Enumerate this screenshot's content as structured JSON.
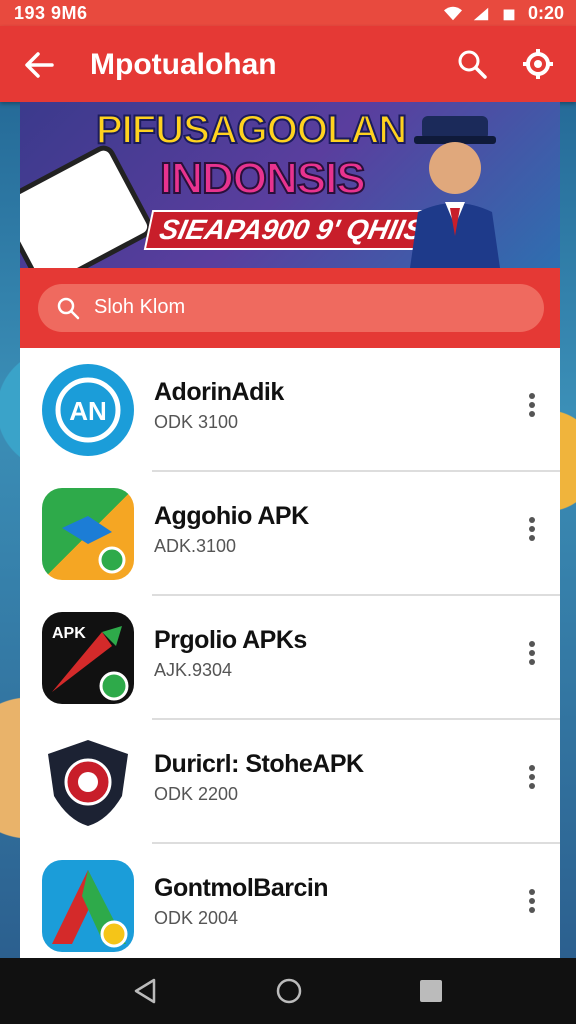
{
  "status_bar": {
    "left_text": "193 9M6",
    "time": "0:20"
  },
  "app_bar": {
    "title": "Mpotualohan",
    "back_icon": "arrow-left-icon",
    "search_icon": "search-icon",
    "settings_icon": "gear-icon"
  },
  "banner": {
    "line1": "PIFUSAGOOLAN",
    "line2": "INDONSIS",
    "line3": "SIEAPA900 9' QHIIS"
  },
  "search": {
    "placeholder": "Sloh Klom"
  },
  "list": {
    "items": [
      {
        "name": "AdorinAdik",
        "sub": "ODK 3100"
      },
      {
        "name": "Aggohio APK",
        "sub": "ADK.3100"
      },
      {
        "name": "Prgolio APKs",
        "sub": "AJK.9304"
      },
      {
        "name": "Duricrl: StoheAPK",
        "sub": "ODK 2200"
      },
      {
        "name": "GontmolBarcin",
        "sub": "ODK 2004"
      }
    ]
  },
  "colors": {
    "primary": "#e53935",
    "status_bar": "#e84a3e",
    "nav_bar": "#111111"
  }
}
